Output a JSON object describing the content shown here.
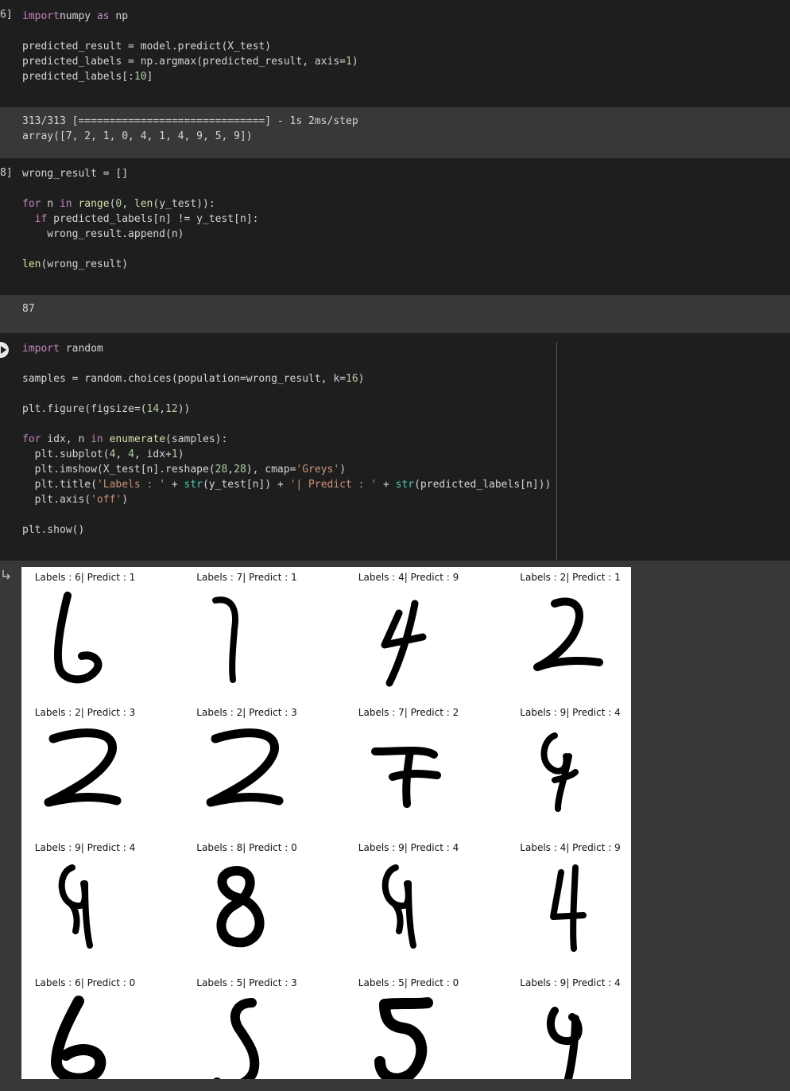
{
  "cells": [
    {
      "gutter": "6]",
      "lines": [
        [
          [
            "kw2",
            "import"
          ],
          [
            "",
            "numpy "
          ],
          [
            "kw2",
            "as"
          ],
          [
            "",
            " np"
          ]
        ],
        [],
        [
          [
            "",
            "predicted_result = model.predict(X_test)"
          ]
        ],
        [
          [
            "",
            "predicted_labels = np.argmax(predicted_result, axis="
          ],
          [
            "num",
            "1"
          ],
          [
            "",
            ")"
          ]
        ],
        [
          [
            "",
            "predicted_labels[:"
          ],
          [
            "num",
            "10"
          ],
          [
            "",
            "]"
          ]
        ]
      ],
      "output": [
        "313/313 [==============================] - 1s 2ms/step",
        "array([7, 2, 1, 0, 4, 1, 4, 9, 5, 9])"
      ]
    },
    {
      "gutter": "8]",
      "lines": [
        [
          [
            "",
            "wrong_result = []"
          ]
        ],
        [],
        [
          [
            "kw2",
            "for"
          ],
          [
            "",
            " n "
          ],
          [
            "kw2",
            "in"
          ],
          [
            "",
            ""
          ],
          [
            "fn",
            " range"
          ],
          [
            "",
            "("
          ],
          [
            "num",
            "0"
          ],
          [
            "",
            ", "
          ],
          [
            "fn",
            "len"
          ],
          [
            "",
            "(y_test)):"
          ]
        ],
        [
          [
            "",
            "  "
          ],
          [
            "kw2",
            "if"
          ],
          [
            "",
            " predicted_labels[n] != y_test[n]:"
          ]
        ],
        [
          [
            "",
            "    wrong_result.append(n)"
          ]
        ],
        [],
        [
          [
            "fn",
            "len"
          ],
          [
            "",
            "(wrong_result)"
          ]
        ]
      ],
      "output": [
        "87"
      ]
    },
    {
      "gutter": "",
      "lines": [
        [
          [
            "kw2",
            "import"
          ],
          [
            "",
            " random"
          ]
        ],
        [],
        [
          [
            "",
            "samples = random.choices(population=wrong_result, k="
          ],
          [
            "num",
            "16"
          ],
          [
            "",
            ")"
          ]
        ],
        [],
        [
          [
            "",
            "plt.figure(figsize=("
          ],
          [
            "num",
            "14"
          ],
          [
            "",
            ","
          ],
          [
            "num",
            "12"
          ],
          [
            "",
            "))"
          ]
        ],
        [],
        [
          [
            "kw2",
            "for"
          ],
          [
            "",
            " idx, n "
          ],
          [
            "kw2",
            "in"
          ],
          [
            "fn",
            " enumerate"
          ],
          [
            "",
            "(samples):"
          ]
        ],
        [
          [
            "",
            "  plt.subplot("
          ],
          [
            "num",
            "4"
          ],
          [
            "",
            ", "
          ],
          [
            "num",
            "4"
          ],
          [
            "",
            ", idx+"
          ],
          [
            "num",
            "1"
          ],
          [
            "",
            ")"
          ]
        ],
        [
          [
            "",
            "  plt.imshow(X_test[n].reshape("
          ],
          [
            "num",
            "28"
          ],
          [
            "",
            ","
          ],
          [
            "num",
            "28"
          ],
          [
            "",
            "), cmap="
          ],
          [
            "str",
            "'Greys'"
          ],
          [
            "",
            ")"
          ]
        ],
        [
          [
            "",
            "  plt.title("
          ],
          [
            "str",
            "'Labels : '"
          ],
          [
            "",
            " + "
          ],
          [
            "bi",
            "str"
          ],
          [
            "",
            "(y_test[n]) + "
          ],
          [
            "str",
            "'| Predict : '"
          ],
          [
            "",
            " + "
          ],
          [
            "bi",
            "str"
          ],
          [
            "",
            "(predicted_labels[n]))"
          ]
        ],
        [
          [
            "",
            "  plt.axis("
          ],
          [
            "str",
            "'off'"
          ],
          [
            "",
            ")"
          ]
        ],
        [],
        [
          [
            "",
            "plt.show()"
          ]
        ]
      ]
    }
  ],
  "figure_titles": [
    "Labels : 6| Predict : 1",
    "Labels : 7| Predict : 1",
    "Labels : 4| Predict : 9",
    "Labels : 2| Predict : 1",
    "Labels : 2| Predict : 3",
    "Labels : 2| Predict : 3",
    "Labels : 7| Predict : 2",
    "Labels : 9| Predict : 4",
    "Labels : 9| Predict : 4",
    "Labels : 8| Predict : 0",
    "Labels : 9| Predict : 4",
    "Labels : 4| Predict : 9",
    "Labels : 6| Predict : 0",
    "Labels : 5| Predict : 3",
    "Labels : 5| Predict : 0",
    "Labels : 9| Predict : 4"
  ],
  "icons": {
    "run": "play-circle-icon",
    "output": "output-redirect-icon"
  }
}
